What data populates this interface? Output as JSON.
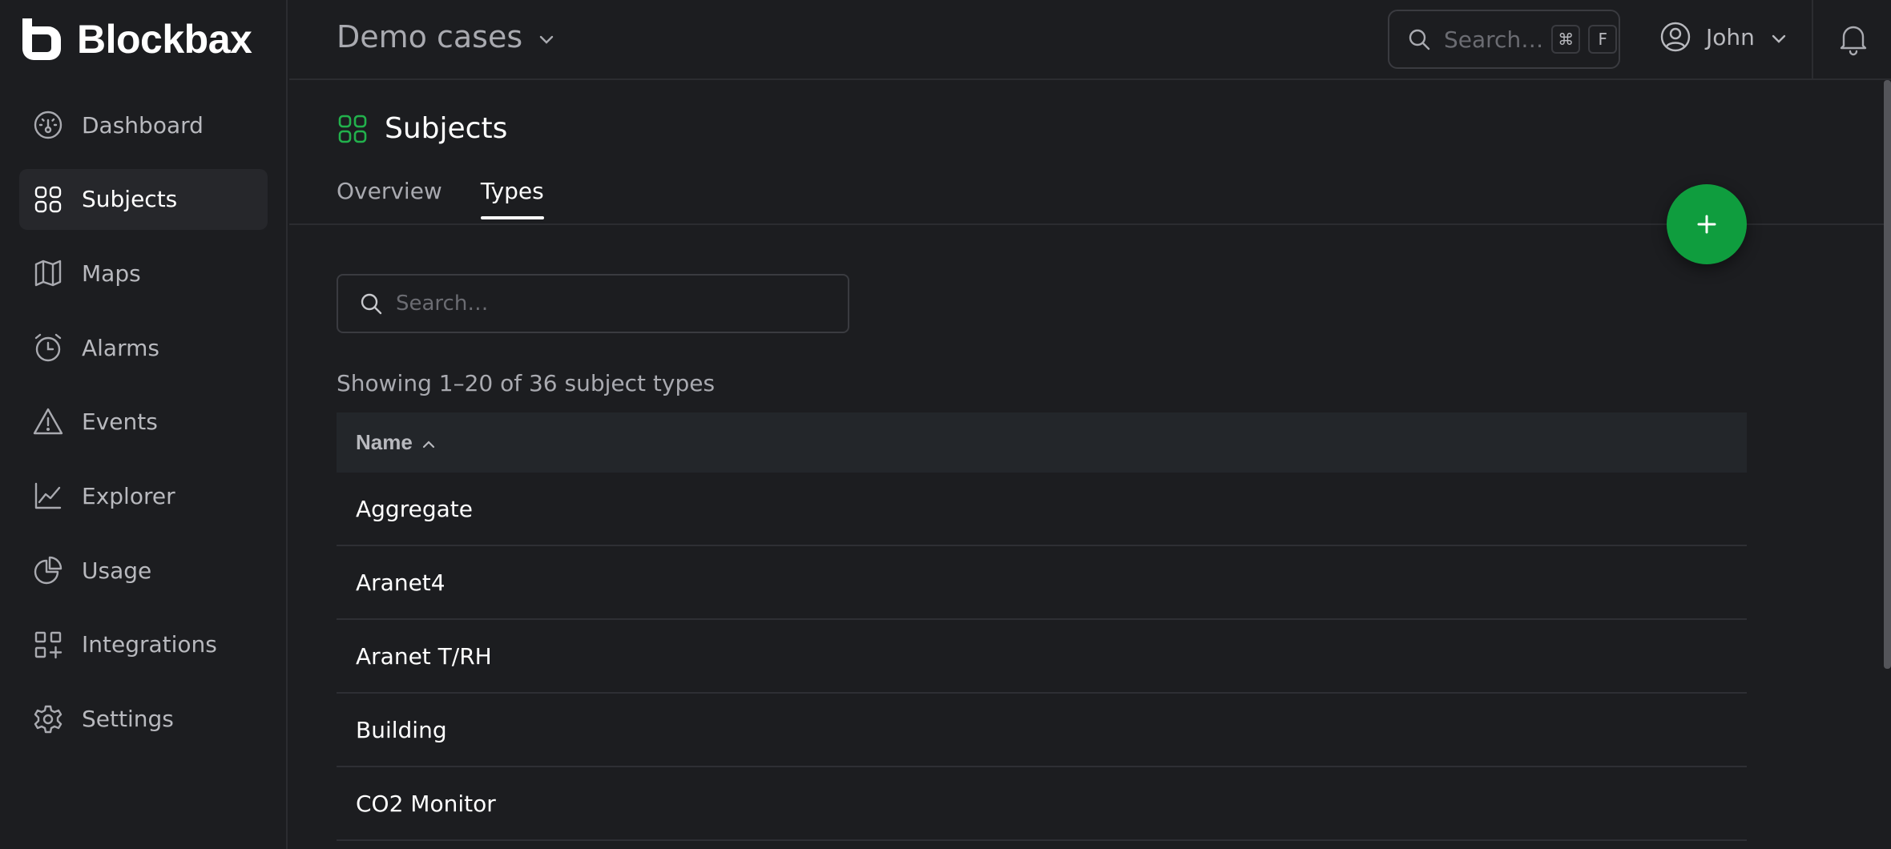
{
  "app": {
    "name": "Blockbax"
  },
  "sidebar": {
    "items": [
      {
        "label": "Dashboard",
        "icon": "dashboard-gauge-icon"
      },
      {
        "label": "Subjects",
        "icon": "grid-icon",
        "active": true
      },
      {
        "label": "Maps",
        "icon": "map-icon"
      },
      {
        "label": "Alarms",
        "icon": "alarm-clock-icon"
      },
      {
        "label": "Events",
        "icon": "warning-triangle-icon"
      },
      {
        "label": "Explorer",
        "icon": "line-chart-icon"
      },
      {
        "label": "Usage",
        "icon": "pie-chart-icon"
      },
      {
        "label": "Integrations",
        "icon": "integrations-grid-plus-icon"
      },
      {
        "label": "Settings",
        "icon": "gear-icon"
      }
    ]
  },
  "header": {
    "workspace": "Demo cases",
    "search_placeholder": "Search…",
    "shortcut_keys": [
      "⌘",
      "F"
    ],
    "user_name": "John"
  },
  "page": {
    "title": "Subjects",
    "tabs": [
      {
        "label": "Overview",
        "active": false
      },
      {
        "label": "Types",
        "active": true
      }
    ],
    "search_placeholder": "Search…",
    "result_count": "Showing 1–20 of 36 subject types",
    "table": {
      "column": "Name",
      "sort": "ascending",
      "rows": [
        "Aggregate",
        "Aranet4",
        "Aranet T/RH",
        "Building",
        "CO2 Monitor"
      ]
    }
  },
  "colors": {
    "accent": "#0f9d3e",
    "subjects_icon": "#22b14c",
    "background": "#1c1d20"
  }
}
